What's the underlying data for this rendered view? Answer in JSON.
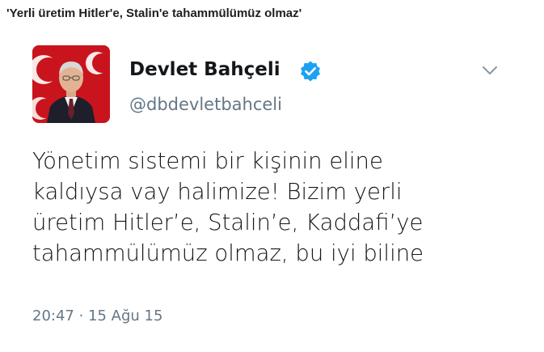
{
  "headline": "'Yerli üretim Hitler'e, Stalin'e tahammülümüz olmaz'",
  "tweet": {
    "author": {
      "display_name": "Devlet Bahçeli",
      "handle": "@dbdevletbahceli",
      "verified": true
    },
    "text_lines": [
      "Yönetim sistemi bir kişinin eline",
      "kaldıysa vay halimize! Bizim yerli",
      "üretim Hitler’e, Stalin’e, Kaddafi’ye",
      "tahammülümüz olmaz, bu iyi biline"
    ],
    "timestamp": "20:47 · 15 Ağu 15"
  },
  "colors": {
    "verified_badge": "#1da1f2",
    "name_text": "#14171a",
    "secondary_text": "#657786",
    "avatar_flag_red": "#c9141d"
  },
  "icons": {
    "verified": "verified-badge-icon",
    "caret": "chevron-down-icon"
  }
}
